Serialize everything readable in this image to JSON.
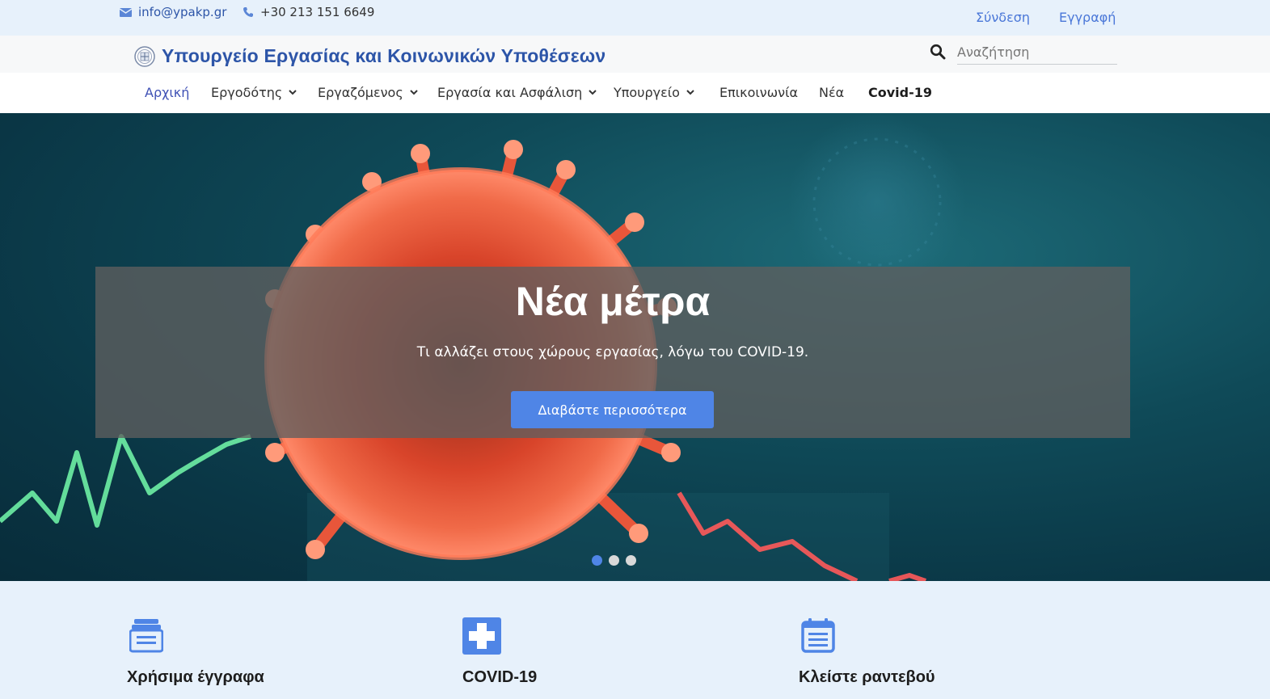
{
  "topbar": {
    "email": "info@ypakp.gr",
    "phone": "+30 213 151 6649",
    "login": "Σύνδεση",
    "register": "Εγγραφή"
  },
  "brand": {
    "title": "Υπουργείο Εργασίας και Κοινωνικών Υποθέσεων",
    "color": "#2d55a8"
  },
  "search": {
    "placeholder": "Αναζήτηση"
  },
  "nav": {
    "items": [
      {
        "label": "Αρχική",
        "dropdown": false,
        "active": true
      },
      {
        "label": "Εργοδότης",
        "dropdown": true
      },
      {
        "label": "Εργαζόμενος",
        "dropdown": true
      },
      {
        "label": "Εργασία και Ασφάλιση",
        "dropdown": true
      },
      {
        "label": "Υπουργείο",
        "dropdown": true
      },
      {
        "label": "Επικοινωνία",
        "dropdown": false
      },
      {
        "label": "Νέα",
        "dropdown": false
      },
      {
        "label": "Covid-19",
        "dropdown": false,
        "emphasis": true
      }
    ]
  },
  "hero": {
    "heading": "Νέα μέτρα",
    "subheading": "Τι αλλάζει στους χώρους εργασίας, λόγω του COVID-19.",
    "button": "Διαβάστε περισσότερα",
    "slides_count": 3,
    "active_slide": 1,
    "accent": "#4f85e6"
  },
  "features": [
    {
      "icon": "documents-icon",
      "title": "Χρήσιμα έγγραφα"
    },
    {
      "icon": "medical-cross-icon",
      "title": "COVID-19"
    },
    {
      "icon": "calendar-icon",
      "title": "Κλείστε ραντεβού"
    }
  ]
}
